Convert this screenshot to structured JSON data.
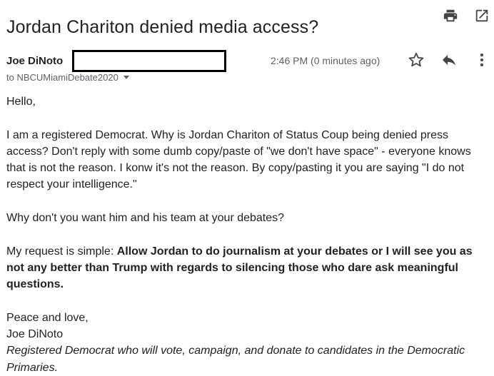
{
  "email": {
    "subject": "Jordan Chariton denied media access?",
    "sender_name": "Joe DiNoto",
    "timestamp": "2:46 PM (0 minutes ago)",
    "recipient": "to NBCUMiamiDebate2020"
  },
  "icons": {
    "print": "printer-icon",
    "open_new": "open-in-new-window-icon",
    "star": "star-icon",
    "reply": "reply-icon",
    "more": "more-vert-icon",
    "recipient_menu": "chevron-down-icon"
  },
  "body": {
    "greeting": "Hello,",
    "para1": "I am a registered Democrat. Why is Jordan Chariton of Status Coup being denied press access? Don't reply with some dumb copy/paste of \"we don't have space\" - everyone knows that is not the reason. I konw it's not the reason. By copy/pasting it you are saying \"I do not respect your intelligence.\"",
    "para2": "Why don't you want him and his team at your debates?",
    "para3_prefix": "My request is simple: ",
    "para3_bold": "Allow Jordan to do journalism at your debates or I will see you as not any better than Trump with regards to silencing those who dare ask meaningful questions.",
    "closing": "Peace and love,",
    "signature_name": "Joe DiNoto",
    "signature_title": "Registered Democrat who will vote, campaign, and donate to candidates in the Democratic Primaries."
  },
  "colors": {
    "text": "#222222",
    "secondary_text": "#5f6368",
    "icon": "#444444"
  }
}
